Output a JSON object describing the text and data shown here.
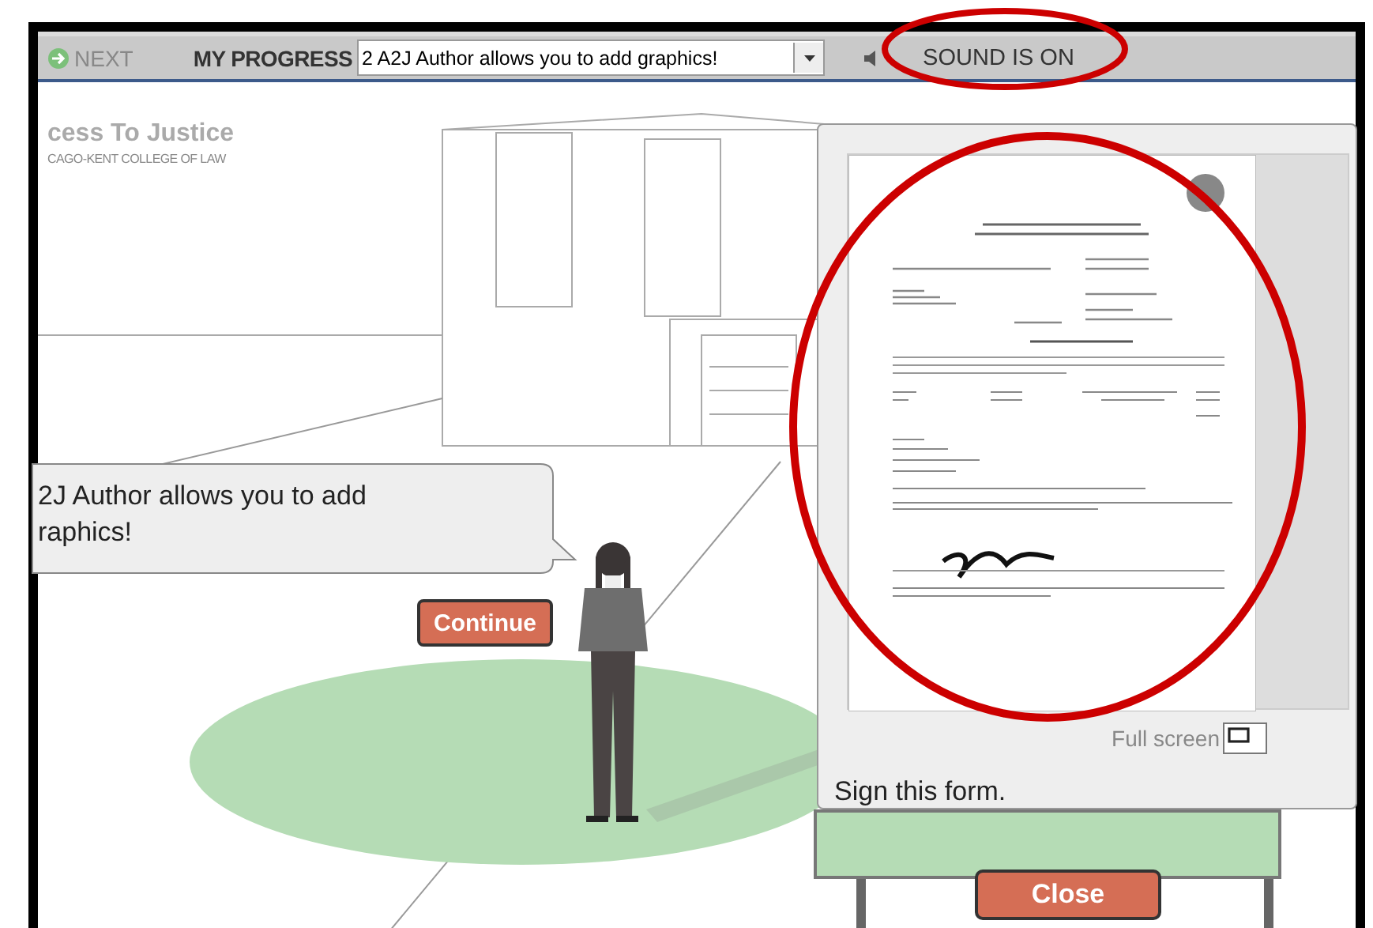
{
  "toolbar": {
    "next_label": "NEXT",
    "progress_label": "MY PROGRESS",
    "progress_select": "2 A2J Author allows you to add graphics!",
    "sound_label": "SOUND IS ON"
  },
  "logo": {
    "title": "cess To Justice",
    "subtitle": "CAGO-KENT COLLEGE OF LAW"
  },
  "question": {
    "lines": [
      "2J Author allows you to add",
      "raphics!"
    ]
  },
  "continue_button": "Continue",
  "popup": {
    "fullscreen_label": "Full screen",
    "caption": "Sign this form."
  },
  "close_button": "Close"
}
